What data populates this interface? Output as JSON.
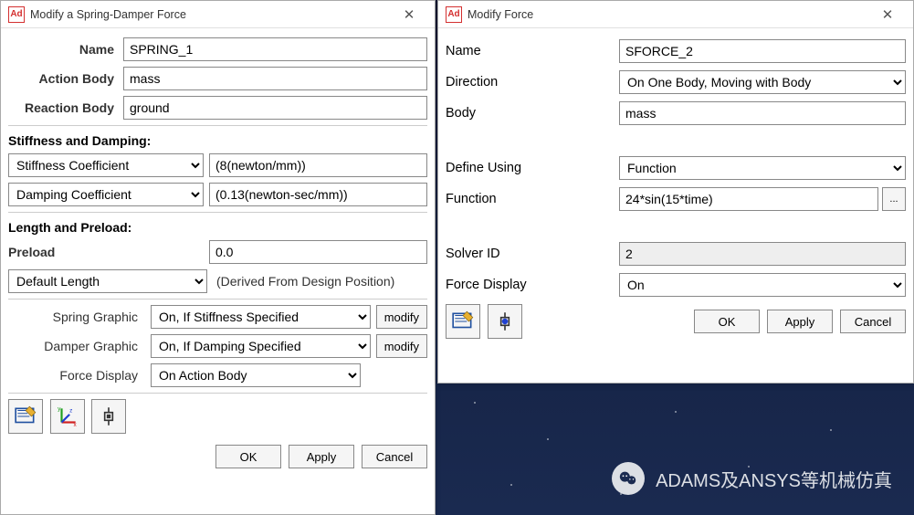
{
  "dialogLeft": {
    "logo": "Ad",
    "title": "Modify a Spring-Damper Force",
    "name_label": "Name",
    "name_value": "SPRING_1",
    "action_body_label": "Action Body",
    "action_body_value": "mass",
    "reaction_body_label": "Reaction Body",
    "reaction_body_value": "ground",
    "section_sd": "Stiffness and Damping:",
    "stiff_coef_label": "Stiffness Coefficient",
    "stiff_coef_value": "(8(newton/mm))",
    "damp_coef_label": "Damping Coefficient",
    "damp_coef_value": "(0.13(newton-sec/mm))",
    "section_lp": "Length and Preload:",
    "preload_label": "Preload",
    "preload_value": "0.0",
    "default_length_label": "Default Length",
    "derived_note": "(Derived From Design Position)",
    "spring_graphic_label": "Spring Graphic",
    "spring_graphic_value": "On, If Stiffness Specified",
    "damper_graphic_label": "Damper Graphic",
    "damper_graphic_value": "On, If Damping Specified",
    "force_display_label": "Force Display",
    "force_display_value": "On Action Body",
    "modify_label": "modify",
    "ok": "OK",
    "apply": "Apply",
    "cancel": "Cancel"
  },
  "dialogRight": {
    "logo": "Ad",
    "title": "Modify Force",
    "name_label": "Name",
    "name_value": "SFORCE_2",
    "direction_label": "Direction",
    "direction_value": "On One Body, Moving with Body",
    "body_label": "Body",
    "body_value": "mass",
    "define_using_label": "Define Using",
    "define_using_value": "Function",
    "function_label": "Function",
    "function_value": "24*sin(15*time)",
    "solver_id_label": "Solver ID",
    "solver_id_value": "2",
    "force_display_label": "Force Display",
    "force_display_value": "On",
    "ok": "OK",
    "apply": "Apply",
    "cancel": "Cancel",
    "dots": "..."
  },
  "watermark": {
    "text": "ADAMS及ANSYS等机械仿真"
  }
}
